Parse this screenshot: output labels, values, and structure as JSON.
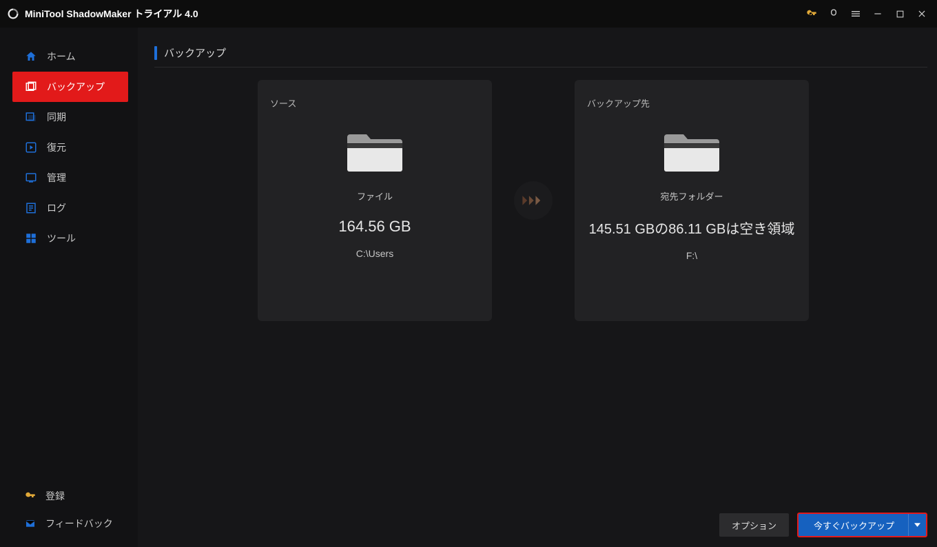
{
  "titlebar": {
    "title": "MiniTool ShadowMaker トライアル 4.0"
  },
  "sidebar": {
    "items": [
      {
        "label": "ホーム"
      },
      {
        "label": "バックアップ"
      },
      {
        "label": "同期"
      },
      {
        "label": "復元"
      },
      {
        "label": "管理"
      },
      {
        "label": "ログ"
      },
      {
        "label": "ツール"
      }
    ],
    "bottom": {
      "register": "登録",
      "feedback": "フィードバック"
    }
  },
  "page": {
    "title": "バックアップ",
    "source": {
      "label": "ソース",
      "type": "ファイル",
      "size": "164.56 GB",
      "path": "C:\\Users"
    },
    "destination": {
      "label": "バックアップ先",
      "type": "宛先フォルダー",
      "space": "145.51 GBの86.11 GBは空き領域",
      "path": "F:\\"
    },
    "footer": {
      "options": "オプション",
      "backup_now": "今すぐバックアップ"
    }
  }
}
